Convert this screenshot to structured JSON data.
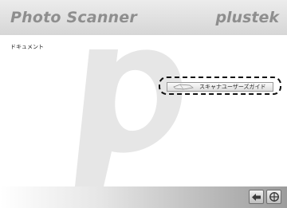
{
  "header": {
    "title": "Photo Scanner",
    "brand": "plustek"
  },
  "content": {
    "section_label": "ドキュメント",
    "guide_button_label": "スキャナユーザーズガイド"
  },
  "icons": {
    "guide_button": "document-icon",
    "back_button": "back-arrow-icon",
    "exit_button": "exit-icon"
  },
  "colors": {
    "header_text": "#8e8e8e",
    "highlight_border": "#111111",
    "background_letter": "#e6e6e6"
  }
}
